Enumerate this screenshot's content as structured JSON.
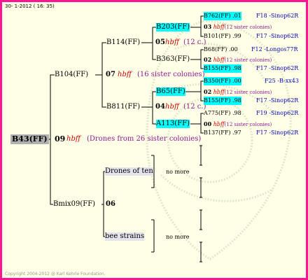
{
  "header": {
    "date": "30-  1-2012 ( 16: 35)"
  },
  "footer": {
    "copyright": "Copyright 2004-2012 @ Karl Kehrle Foundation."
  },
  "root": {
    "id": "B43(FF)",
    "num": "09",
    "hbff": "hbff",
    "note": "(Drones from 26 sister colonies)"
  },
  "gen1": {
    "father": {
      "id": "B104(FF)",
      "num": "07",
      "hbff": "hbff",
      "note": "(16 sister colonies)"
    },
    "mother": {
      "id": "Bmix09(FF)",
      "num": "06"
    }
  },
  "gen2": {
    "b114": {
      "id": "B114(FF)"
    },
    "b811": {
      "id": "B811(FF)"
    },
    "drones": {
      "label": "Drones of ten"
    },
    "strains": {
      "label": "bee strains"
    }
  },
  "gen3": {
    "b203": {
      "id": "B203(FF)",
      "num": "05",
      "hbff": "hbff",
      "note": "(12 c.)"
    },
    "b363": {
      "id": "B363(FF)"
    },
    "b65": {
      "id": "B65(FF)",
      "num": "04",
      "hbff": "hbff",
      "note": "(12 c.)"
    },
    "a113": {
      "id": "A113(FF)"
    },
    "nomore1": "no more",
    "nomore2": "no more"
  },
  "gen4": [
    {
      "id": "B762(FF)",
      "val": ".01",
      "src": "F18 -Sinop62R"
    },
    {
      "num": "03",
      "hbff": "hbff",
      "note": "(12 sister colonies)"
    },
    {
      "id": "B101(FF)",
      "val": ".99",
      "src": "F17 -Sinop62R"
    },
    {
      "id": "B68(FF)",
      "val": ".00",
      "src": "F12 -Longos77R"
    },
    {
      "num": "02",
      "hbff": "hbff",
      "note": "(12 sister colonies)"
    },
    {
      "id": "B155(FF)",
      "val": ".98",
      "src": "F17 -Sinop62R"
    },
    {
      "id": "B350(FF)",
      "val": ".00",
      "src": "F25 -B-xx43"
    },
    {
      "num": "02",
      "hbff": "hbff",
      "note": "(12 sister colonies)"
    },
    {
      "id": "B155(FF)",
      "val": ".98",
      "src": "F17 -Sinop62R"
    },
    {
      "id": "A775(FF)",
      "val": ".98",
      "src": "F19 -Sinop62R"
    },
    {
      "num": "00",
      "hbff": "hbff",
      "note": "(12 sister colonies)"
    },
    {
      "id": "B137(FF)",
      "val": ".97",
      "src": "F17 -Sinop62R"
    }
  ]
}
